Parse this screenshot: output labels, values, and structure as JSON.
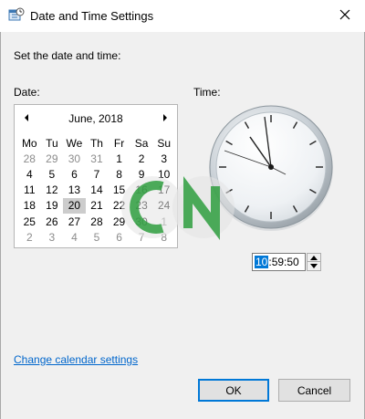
{
  "window": {
    "title": "Date and Time Settings"
  },
  "instructions": "Set the date and time:",
  "labels": {
    "date": "Date:",
    "time": "Time:"
  },
  "calendar": {
    "month_label": "June, 2018",
    "day_headers": [
      "Mo",
      "Tu",
      "We",
      "Th",
      "Fr",
      "Sa",
      "Su"
    ],
    "weeks": [
      [
        {
          "d": "28",
          "om": true
        },
        {
          "d": "29",
          "om": true
        },
        {
          "d": "30",
          "om": true
        },
        {
          "d": "31",
          "om": true
        },
        {
          "d": "1"
        },
        {
          "d": "2"
        },
        {
          "d": "3"
        }
      ],
      [
        {
          "d": "4"
        },
        {
          "d": "5"
        },
        {
          "d": "6"
        },
        {
          "d": "7"
        },
        {
          "d": "8"
        },
        {
          "d": "9"
        },
        {
          "d": "10"
        }
      ],
      [
        {
          "d": "11"
        },
        {
          "d": "12"
        },
        {
          "d": "13"
        },
        {
          "d": "14"
        },
        {
          "d": "15"
        },
        {
          "d": "16"
        },
        {
          "d": "17"
        }
      ],
      [
        {
          "d": "18"
        },
        {
          "d": "19"
        },
        {
          "d": "20",
          "sel": true
        },
        {
          "d": "21"
        },
        {
          "d": "22"
        },
        {
          "d": "23"
        },
        {
          "d": "24"
        }
      ],
      [
        {
          "d": "25"
        },
        {
          "d": "26"
        },
        {
          "d": "27"
        },
        {
          "d": "28"
        },
        {
          "d": "29"
        },
        {
          "d": "30"
        },
        {
          "d": "1",
          "om": true
        }
      ],
      [
        {
          "d": "2",
          "om": true
        },
        {
          "d": "3",
          "om": true
        },
        {
          "d": "4",
          "om": true
        },
        {
          "d": "5",
          "om": true
        },
        {
          "d": "6",
          "om": true
        },
        {
          "d": "7",
          "om": true
        },
        {
          "d": "8",
          "om": true
        }
      ]
    ],
    "selected_day": "20"
  },
  "time": {
    "hours": "10",
    "minutes_seconds": ":59:50"
  },
  "link": "Change calendar settings",
  "buttons": {
    "ok": "OK",
    "cancel": "Cancel"
  },
  "colors": {
    "accent": "#0078d7",
    "link": "#0066cc",
    "background": "#f0f0f0",
    "watermark_green": "#2e9e3e"
  },
  "icons": {
    "app": "calendar-clock-icon",
    "close": "close-icon",
    "prev": "chevron-left-icon",
    "next": "chevron-right-icon",
    "spin_up": "caret-up-icon",
    "spin_down": "caret-down-icon"
  }
}
